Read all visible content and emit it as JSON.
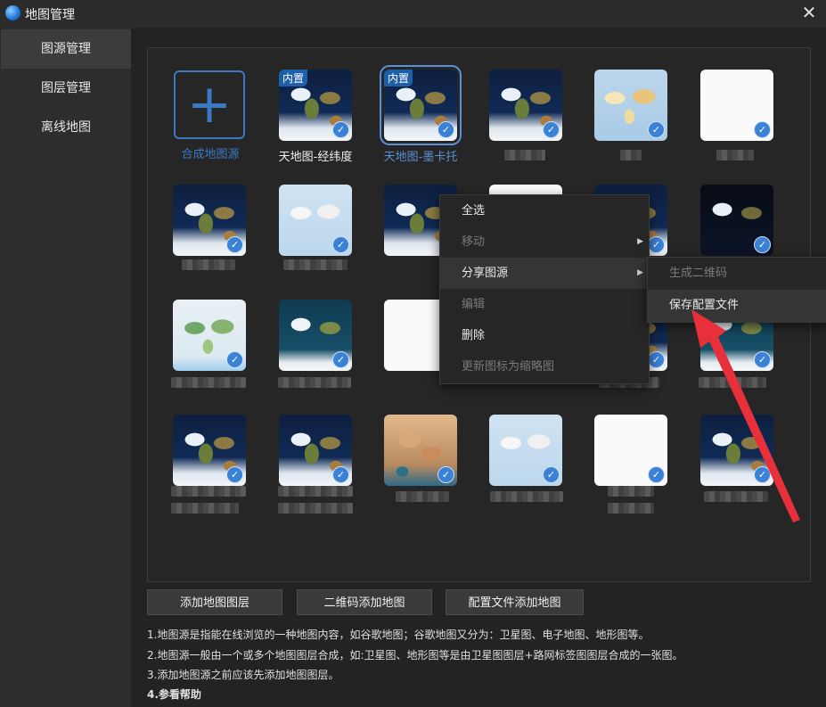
{
  "window": {
    "title": "地图管理",
    "close_glyph": "✕"
  },
  "sidebar": {
    "items": [
      {
        "label": "图源管理"
      },
      {
        "label": "图层管理"
      },
      {
        "label": "离线地图"
      }
    ]
  },
  "gallery": {
    "add_tile": {
      "label": "合成地图源",
      "plus": "+"
    },
    "badge_text": "内置",
    "check_glyph": "✓",
    "tile_labels": {
      "tianditu_latlon": "天地图-经纬度",
      "tianditu_mercator": "天地图-墨卡托"
    }
  },
  "context_menu": {
    "items": [
      {
        "label": "全选"
      },
      {
        "label": "移动"
      },
      {
        "label": "分享图源"
      },
      {
        "label": "编辑"
      },
      {
        "label": "删除"
      },
      {
        "label": "更新图标为缩略图"
      }
    ],
    "submenu": [
      {
        "label": "生成二维码"
      },
      {
        "label": "保存配置文件"
      }
    ]
  },
  "buttons": {
    "add_layer": "添加地图图层",
    "qr_add": "二维码添加地图",
    "config_add": "配置文件添加地图"
  },
  "help": {
    "line1": "1.地图源是指能在线浏览的一种地图内容，如谷歌地图；谷歌地图又分为：卫星图、电子地图、地形图等。",
    "line2": "2.地图源一般由一个或多个地图图层合成，如:卫星图、地形图等是由卫星图图层+路网标签图图层合成的一张图。",
    "line3": "3.添加地图源之前应该先添加地图图层。",
    "line4": "4.参看帮助"
  },
  "colors": {
    "accent": "#3a79c4",
    "selected_outline": "#5b8fd6",
    "annotation_arrow": "#e8303a"
  }
}
